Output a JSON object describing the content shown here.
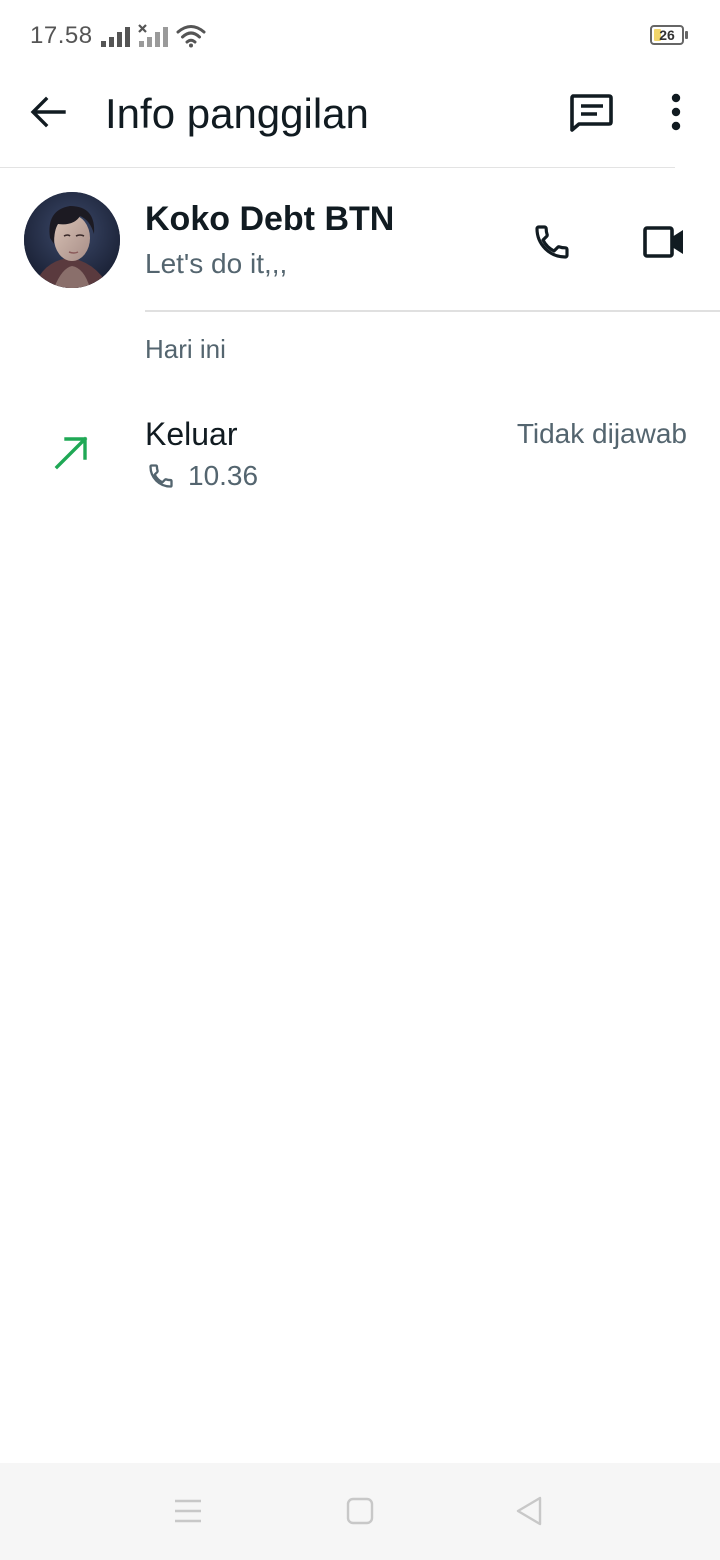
{
  "status_bar": {
    "time": "17.58",
    "battery_level": "26",
    "battery_fraction": 0.26,
    "icons": [
      "signal-icon",
      "signal-no-service-icon",
      "wifi-icon",
      "battery-icon"
    ]
  },
  "app_bar": {
    "title": "Info panggilan",
    "icons": [
      "back-arrow-icon",
      "message-icon",
      "more-vert-icon"
    ]
  },
  "contact": {
    "name": "Koko Debt BTN",
    "status": "Let's do it,,,",
    "icons": [
      "phone-icon",
      "video-camera-icon"
    ]
  },
  "history": {
    "section_label": "Hari ini",
    "calls": [
      {
        "type": "Keluar",
        "time": "10.36",
        "result": "Tidak dijawab",
        "direction_icon": "outgoing-arrow-icon",
        "media_icon": "phone-icon"
      }
    ]
  },
  "nav_bar": {
    "icons": [
      "menu-icon",
      "home-icon",
      "back-triangle-icon"
    ]
  },
  "colors": {
    "text_primary": "#111b21",
    "text_secondary": "#54656f",
    "outgoing_arrow": "#1fa855",
    "divider": "#e0e0e0",
    "nav_background": "#f6f6f6"
  }
}
